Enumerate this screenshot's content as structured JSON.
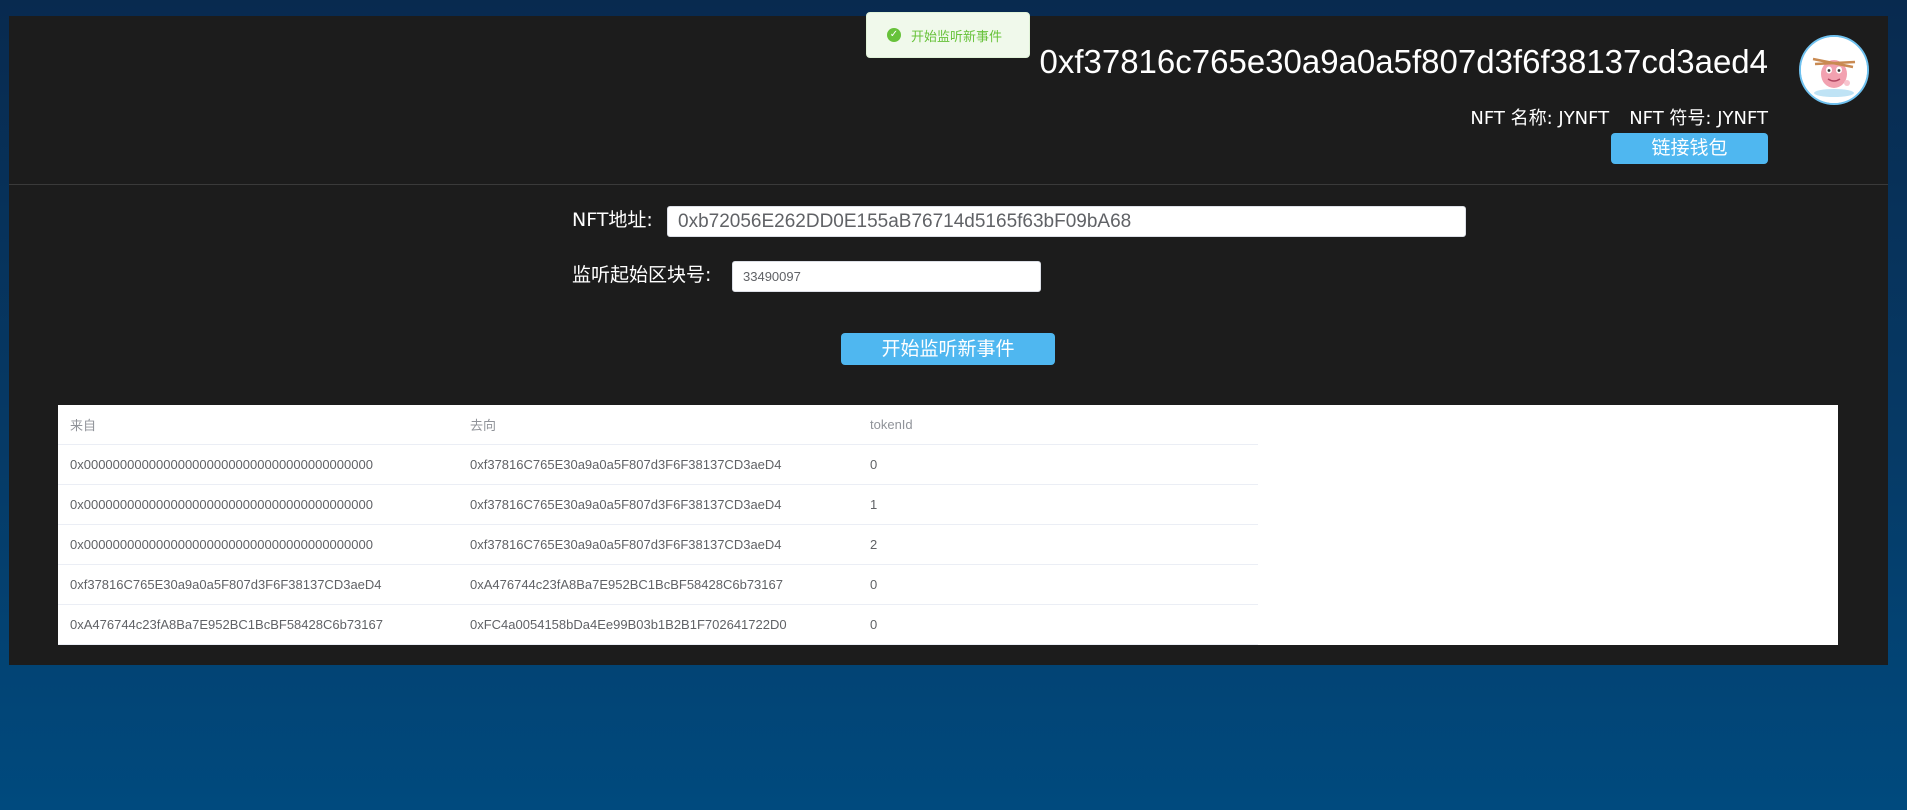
{
  "header": {
    "account_address": "0xf37816c765e30a9a0a5f807d3f6f38137cd3aed4",
    "nft_name": "NFT 名称: JYNFT",
    "nft_symbol": "NFT 符号: JYNFT",
    "connect_wallet_label": "链接钱包"
  },
  "toast": {
    "message": "开始监听新事件",
    "icon": "check-circle-icon",
    "color": "#67c23a"
  },
  "form": {
    "nft_address_label": "NFT地址:",
    "nft_address_value": "0xb72056E262DD0E155aB76714d5165f63bF09bA68",
    "start_block_label": "监听起始区块号:",
    "start_block_value": "33490097",
    "listen_button_label": "开始监听新事件"
  },
  "table": {
    "columns": [
      "来自",
      "去向",
      "tokenId"
    ],
    "rows": [
      [
        "0x0000000000000000000000000000000000000000",
        "0xf37816C765E30a9a0a5F807d3F6F38137CD3aeD4",
        "0"
      ],
      [
        "0x0000000000000000000000000000000000000000",
        "0xf37816C765E30a9a0a5F807d3F6F38137CD3aeD4",
        "1"
      ],
      [
        "0x0000000000000000000000000000000000000000",
        "0xf37816C765E30a9a0a5F807d3F6F38137CD3aeD4",
        "2"
      ],
      [
        "0xf37816C765E30a9a0a5F807d3F6F38137CD3aeD4",
        "0xA476744c23fA8Ba7E952BC1BcBF58428C6b73167",
        "0"
      ],
      [
        "0xA476744c23fA8Ba7E952BC1BcBF58428C6b73167",
        "0xFC4a0054158bDa4Ee99B03b1B2B1F702641722D0",
        "0"
      ]
    ]
  },
  "colors": {
    "accent": "#4fb7f0",
    "panel": "#1c1c1c",
    "success": "#67c23a"
  }
}
